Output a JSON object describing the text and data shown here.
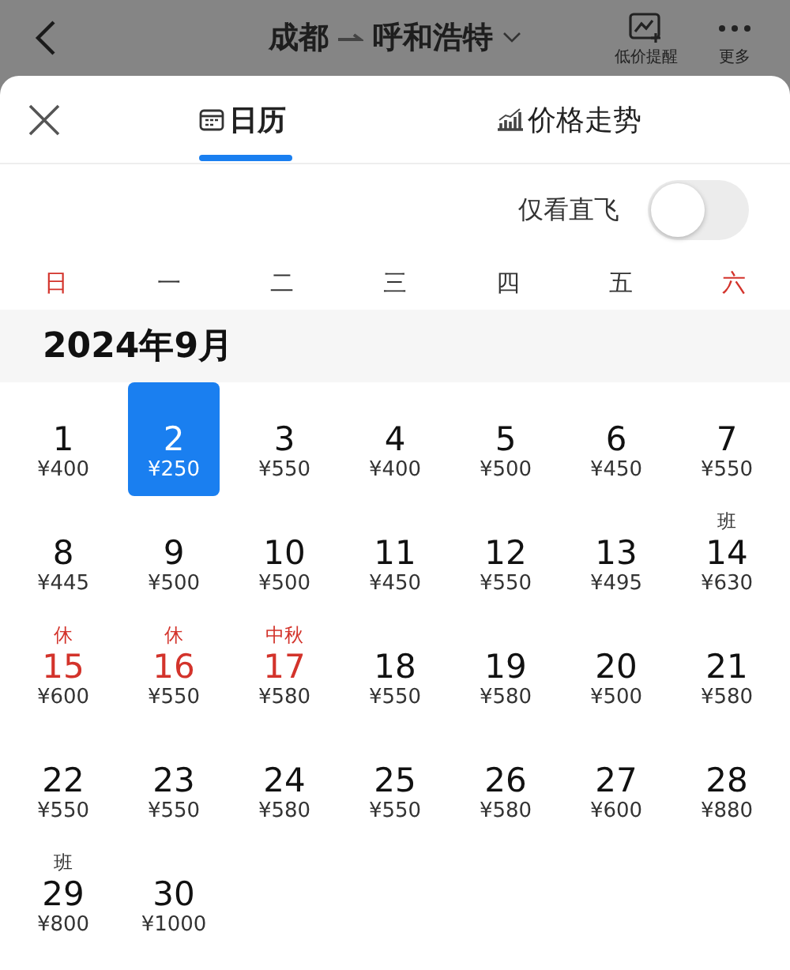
{
  "header": {
    "title_from": "成都",
    "title_to": "呼和浩特",
    "actions": [
      {
        "label": "低价提醒",
        "kind": "chart"
      },
      {
        "label": "更多",
        "kind": "more"
      }
    ]
  },
  "tabs": [
    {
      "label": "日历",
      "kind": "calendar",
      "selected": true
    },
    {
      "label": "价格走势",
      "kind": "trend",
      "selected": false
    }
  ],
  "direct_filter": {
    "label": "仅看直飞",
    "on": false
  },
  "weekdays": [
    {
      "label": "日",
      "weekend": true
    },
    {
      "label": "一",
      "weekend": false
    },
    {
      "label": "二",
      "weekend": false
    },
    {
      "label": "三",
      "weekend": false
    },
    {
      "label": "四",
      "weekend": false
    },
    {
      "label": "五",
      "weekend": false
    },
    {
      "label": "六",
      "weekend": true
    }
  ],
  "month": "2024年9月",
  "days": [
    {
      "date": "1",
      "price": "¥400",
      "holiday": false,
      "selected": false
    },
    {
      "date": "2",
      "price": "¥250",
      "holiday": false,
      "selected": true
    },
    {
      "date": "3",
      "price": "¥550",
      "holiday": false,
      "selected": false
    },
    {
      "date": "4",
      "price": "¥400",
      "holiday": false,
      "selected": false
    },
    {
      "date": "5",
      "price": "¥500",
      "holiday": false,
      "selected": false
    },
    {
      "date": "6",
      "price": "¥450",
      "holiday": false,
      "selected": false
    },
    {
      "date": "7",
      "price": "¥550",
      "holiday": false,
      "selected": false
    },
    {
      "date": "8",
      "price": "¥445",
      "holiday": false,
      "selected": false
    },
    {
      "date": "9",
      "price": "¥500",
      "holiday": false,
      "selected": false
    },
    {
      "date": "10",
      "price": "¥500",
      "holiday": false,
      "selected": false
    },
    {
      "date": "11",
      "price": "¥450",
      "holiday": false,
      "selected": false
    },
    {
      "date": "12",
      "price": "¥550",
      "holiday": false,
      "selected": false
    },
    {
      "date": "13",
      "price": "¥495",
      "holiday": false,
      "selected": false
    },
    {
      "date": "14",
      "price": "¥630",
      "note": "班",
      "holiday": false,
      "selected": false
    },
    {
      "date": "15",
      "price": "¥600",
      "note": "休",
      "holiday": true,
      "selected": false
    },
    {
      "date": "16",
      "price": "¥550",
      "note": "休",
      "holiday": true,
      "selected": false
    },
    {
      "date": "17",
      "price": "¥580",
      "note": "中秋",
      "holiday": true,
      "selected": false
    },
    {
      "date": "18",
      "price": "¥550",
      "holiday": false,
      "selected": false
    },
    {
      "date": "19",
      "price": "¥580",
      "holiday": false,
      "selected": false
    },
    {
      "date": "20",
      "price": "¥500",
      "holiday": false,
      "selected": false
    },
    {
      "date": "21",
      "price": "¥580",
      "holiday": false,
      "selected": false
    },
    {
      "date": "22",
      "price": "¥550",
      "holiday": false,
      "selected": false
    },
    {
      "date": "23",
      "price": "¥550",
      "holiday": false,
      "selected": false
    },
    {
      "date": "24",
      "price": "¥580",
      "holiday": false,
      "selected": false
    },
    {
      "date": "25",
      "price": "¥550",
      "holiday": false,
      "selected": false
    },
    {
      "date": "26",
      "price": "¥580",
      "holiday": false,
      "selected": false
    },
    {
      "date": "27",
      "price": "¥600",
      "holiday": false,
      "selected": false
    },
    {
      "date": "28",
      "price": "¥880",
      "holiday": false,
      "selected": false
    },
    {
      "date": "29",
      "price": "¥800",
      "note": "班",
      "holiday": false,
      "selected": false
    },
    {
      "date": "30",
      "price": "¥1000",
      "holiday": false,
      "selected": false
    }
  ]
}
